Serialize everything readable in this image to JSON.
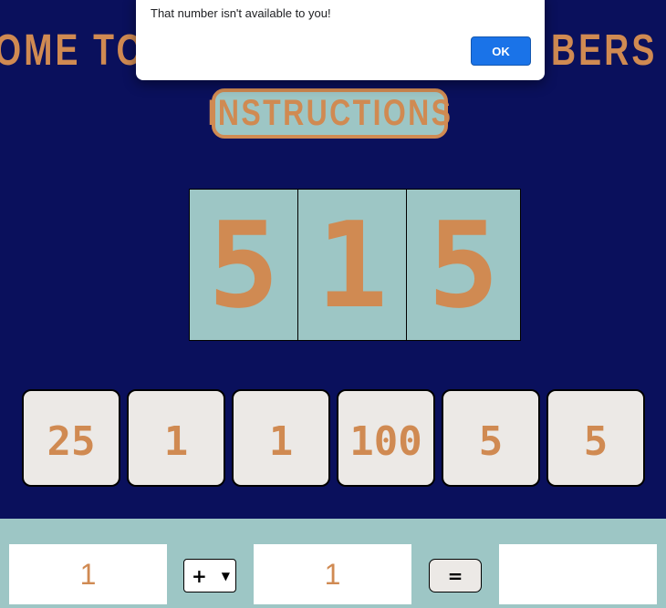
{
  "header": {
    "title_left": "OME TO",
    "title_right": "BERS C"
  },
  "instructions_label": "INSTRUCTIONS",
  "target": {
    "digits": [
      "5",
      "1",
      "5"
    ]
  },
  "tiles": [
    "25",
    "1",
    "1",
    "100",
    "5",
    "5"
  ],
  "calc": {
    "left_operand": "1",
    "operator": "+",
    "right_operand": "1",
    "equals_label": "=",
    "result": ""
  },
  "dialog": {
    "message": "That number isn't available to you!",
    "ok_label": "OK"
  },
  "colors": {
    "background": "#0a105c",
    "accent": "#d08a52",
    "panel": "#9dc6c5",
    "tile": "#ece9e6",
    "dialog_button": "#1a73e8"
  }
}
